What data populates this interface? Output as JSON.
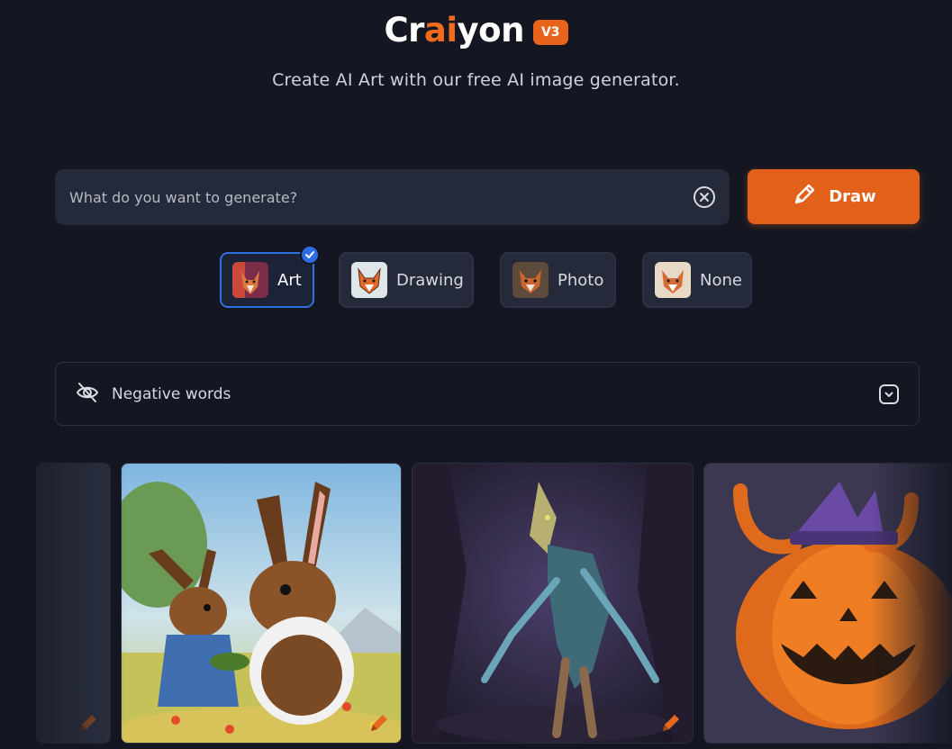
{
  "header": {
    "logo": {
      "text_start": "Cr",
      "text_accent": "ai",
      "text_end": "yon",
      "version": "V3"
    },
    "subtitle": "Create AI Art with our free AI image generator."
  },
  "prompt": {
    "placeholder": "What do you want to generate?",
    "value": "",
    "clear_icon": "close-circle-icon"
  },
  "draw_button": {
    "label": "Draw",
    "icon": "pencil-icon"
  },
  "styles": [
    {
      "label": "Art",
      "selected": true,
      "icon": "fox-thumbnail-art"
    },
    {
      "label": "Drawing",
      "selected": false,
      "icon": "fox-thumbnail-drawing"
    },
    {
      "label": "Photo",
      "selected": false,
      "icon": "fox-thumbnail-photo"
    },
    {
      "label": "None",
      "selected": false,
      "icon": "fox-thumbnail-none"
    }
  ],
  "negative_words": {
    "label": "Negative words",
    "icon": "eye-off-icon",
    "toggle_icon": "chevron-down-icon"
  },
  "gallery": {
    "items": [
      {
        "subject": "partial-card",
        "icon": "pencil-icon"
      },
      {
        "subject": "rabbits",
        "icon": "pencil-icon"
      },
      {
        "subject": "creature",
        "icon": "pencil-icon"
      },
      {
        "subject": "pumpkin",
        "icon": "pencil-icon"
      }
    ]
  },
  "colors": {
    "background": "#141722",
    "accent": "#e3601b",
    "selected": "#2f6fe0",
    "surface": "#252a3b"
  }
}
